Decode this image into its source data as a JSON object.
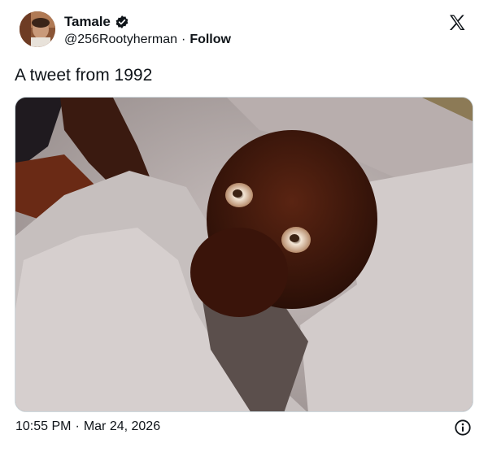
{
  "user": {
    "display_name": "Tamale",
    "handle": "@256Rootyherman",
    "separator": "·",
    "follow_label": "Follow",
    "verified": true
  },
  "tweet": {
    "text": "A tweet from 1992",
    "time": "10:55 PM",
    "date": "Mar 24, 2026",
    "separator": "·"
  },
  "icons": {
    "verified": "verified-badge-icon",
    "brand": "x-logo-icon",
    "info": "info-icon"
  },
  "colors": {
    "text": "#0f1419",
    "verified_badge": "#0f1419",
    "media_border": "#cfd9de"
  }
}
